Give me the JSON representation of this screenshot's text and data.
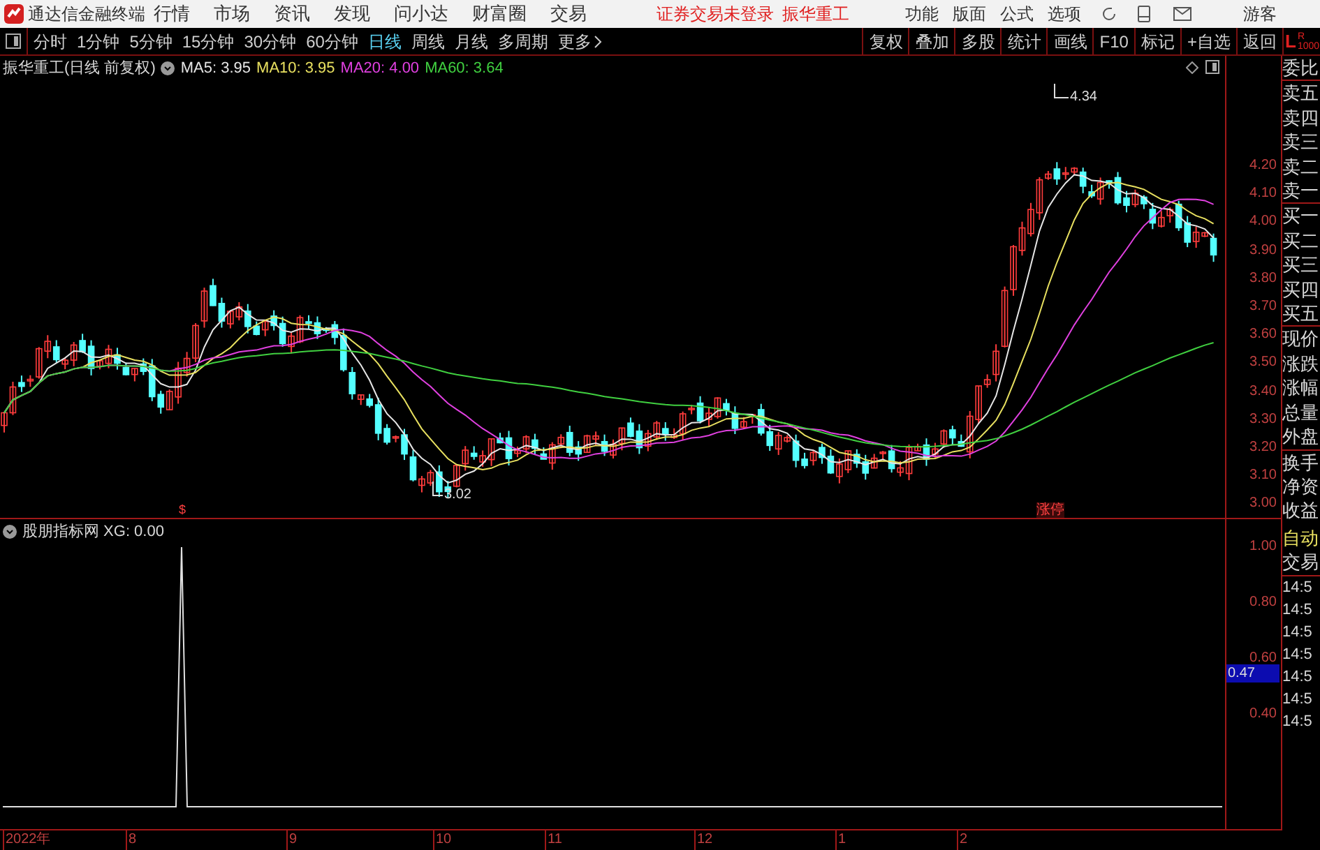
{
  "app_title": "通达信金融终端",
  "menu": [
    "行情",
    "市场",
    "资讯",
    "发现",
    "问小达",
    "财富圈",
    "交易"
  ],
  "login_status": "证券交易未登录",
  "stock_link": "振华重工",
  "right_menu": [
    "功能",
    "版面",
    "公式",
    "选项"
  ],
  "user": "游客",
  "periods": [
    {
      "label": "分时",
      "selected": false
    },
    {
      "label": "1分钟",
      "selected": false
    },
    {
      "label": "5分钟",
      "selected": false
    },
    {
      "label": "15分钟",
      "selected": false
    },
    {
      "label": "30分钟",
      "selected": false
    },
    {
      "label": "60分钟",
      "selected": false
    },
    {
      "label": "日线",
      "selected": true
    },
    {
      "label": "周线",
      "selected": false
    },
    {
      "label": "月线",
      "selected": false
    },
    {
      "label": "多周期",
      "selected": false
    }
  ],
  "more": "更多",
  "tools": [
    "复权",
    "叠加",
    "多股",
    "统计",
    "画线",
    "F10",
    "标记",
    "+自选",
    "返回"
  ],
  "chart": {
    "title": "振华重工(日线 前复权)",
    "ma": [
      {
        "label": "MA5: 3.95",
        "color": "#e6e6e6"
      },
      {
        "label": "MA10: 3.95",
        "color": "#e8e060"
      },
      {
        "label": "MA20: 4.00",
        "color": "#e040e0"
      },
      {
        "label": "MA60: 3.64",
        "color": "#40d040"
      }
    ],
    "high_label": "4.34",
    "low_label": "3.02",
    "limit_tag": "涨停",
    "marker": "$",
    "price_ticks": [
      "4.20",
      "4.10",
      "4.00",
      "3.90",
      "3.80",
      "3.70",
      "3.60",
      "3.50",
      "3.40",
      "3.30",
      "3.20",
      "3.10",
      "3.00"
    ]
  },
  "indicator": {
    "title": "股朋指标网 XG: 0.00",
    "ticks": [
      "1.00",
      "0.80",
      "0.60",
      "0.40"
    ],
    "cursor_value": "0.47"
  },
  "dates": [
    "2022年",
    "8",
    "9",
    "10",
    "11",
    "12",
    "1",
    "2"
  ],
  "quote_panel": {
    "header": "L",
    "header_sub": "R",
    "header_num": "1000",
    "fields": [
      "委比",
      "卖五",
      "卖四",
      "卖三",
      "卖二",
      "卖一",
      "买一",
      "买二",
      "买三",
      "买四",
      "买五",
      "现价",
      "涨跌",
      "涨幅",
      "总量",
      "外盘",
      "换手",
      "净资",
      "收益"
    ],
    "mode": "自动",
    "trade": "交易",
    "times": [
      "14:5",
      "14:5",
      "14:5",
      "14:5",
      "14:5",
      "14:5",
      "14:5"
    ]
  }
}
